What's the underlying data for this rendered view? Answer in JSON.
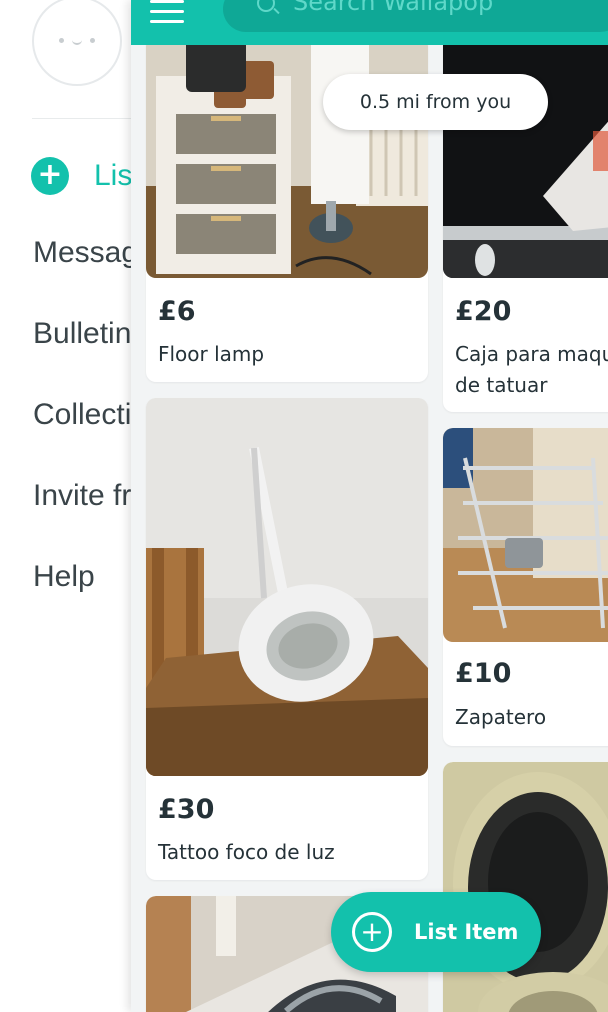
{
  "drawer": {
    "list_label": "List Item",
    "items": [
      "Messages",
      "Bulletin",
      "Collections",
      "Invite friends",
      "Help"
    ]
  },
  "topbar": {
    "search_placeholder": "Search Wallapop"
  },
  "distance_label": "0.5 mi from you",
  "products": [
    {
      "price": "£6",
      "title": "Floor lamp"
    },
    {
      "price": "£20",
      "title_lines": [
        "Caja para maquina",
        "de tatuar"
      ]
    },
    {
      "price": "£30",
      "title": "Tattoo foco de luz"
    },
    {
      "price": "£10",
      "title": "Zapatero"
    }
  ],
  "fab": {
    "label": "List Item"
  },
  "colors": {
    "accent": "#13c1ac",
    "background": "#f2f4f5",
    "text": "#253238"
  }
}
